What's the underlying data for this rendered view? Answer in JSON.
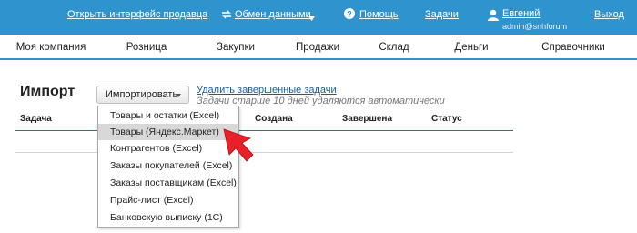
{
  "header": {
    "seller_link": "Открыть интерфейс продавца",
    "exchange_label": "Обмен данными",
    "help_label": "Помощь",
    "tasks_label": "Задачи",
    "user_name": "Евгений",
    "user_email": "admin@snhforum",
    "logout_label": "Выход"
  },
  "tabs": [
    {
      "label": "Моя компания"
    },
    {
      "label": "Розница"
    },
    {
      "label": "Закупки"
    },
    {
      "label": "Продажи"
    },
    {
      "label": "Склад"
    },
    {
      "label": "Деньги"
    },
    {
      "label": "Справочники"
    }
  ],
  "page": {
    "title": "Импорт",
    "import_button": "Импортировать",
    "delete_link": "Удалить завершенные задачи",
    "hint": "Задачи старше 10 дней удаляются автоматически"
  },
  "table": {
    "columns": [
      "Задача",
      "Создана",
      "Завершена",
      "Статус"
    ]
  },
  "menu": {
    "items": [
      "Товары и остатки (Excel)",
      "Товары (Яндекс.Маркет)",
      "Контрагентов (Excel)",
      "Заказы покупателей (Excel)",
      "Заказы поставщикам (Excel)",
      "Прайс-лист (Excel)",
      "Банковскую выписку (1С)"
    ],
    "highlighted_index": 1
  },
  "colors": {
    "header_bg": "#2f93ce",
    "link": "#1f5a96",
    "arrow": "#e8202a"
  },
  "icons": [
    "exchange-icon",
    "help-icon",
    "user-icon",
    "pointer-arrow-icon"
  ]
}
